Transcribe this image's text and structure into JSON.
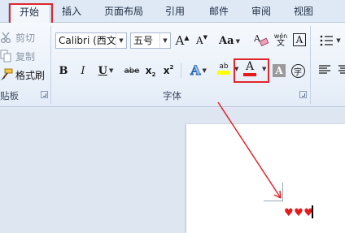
{
  "tabs": [
    "开始",
    "插入",
    "页面布局",
    "引用",
    "邮件",
    "审阅",
    "视图"
  ],
  "clipboard": {
    "cut_label": "剪切",
    "copy_label": "复制",
    "format_painter_label": "格式刷",
    "group_label": "贴板"
  },
  "font": {
    "font_name": "Calibri (西文",
    "font_size": "五号",
    "grow_label": "A",
    "shrink_label": "A",
    "change_case_label": "Aa",
    "bold_label": "B",
    "italic_label": "I",
    "underline_label": "U",
    "strike_label": "abe",
    "subscript_label": "x",
    "superscript_label": "x",
    "text_effects_label": "A",
    "highlight_label": "ab",
    "font_color_label": "A",
    "char_shading_label": "A",
    "enclose_label": "字",
    "pinyin_label": "wén",
    "border_label": "A",
    "group_label": "字体"
  },
  "document": {
    "hearts": "♥♥♥"
  },
  "colors": {
    "highlight_red": "#e0262a",
    "font_color_red": "#e41b1b",
    "highlighter_yellow": "#ffff00",
    "accent_blue": "#1e5bb5"
  }
}
